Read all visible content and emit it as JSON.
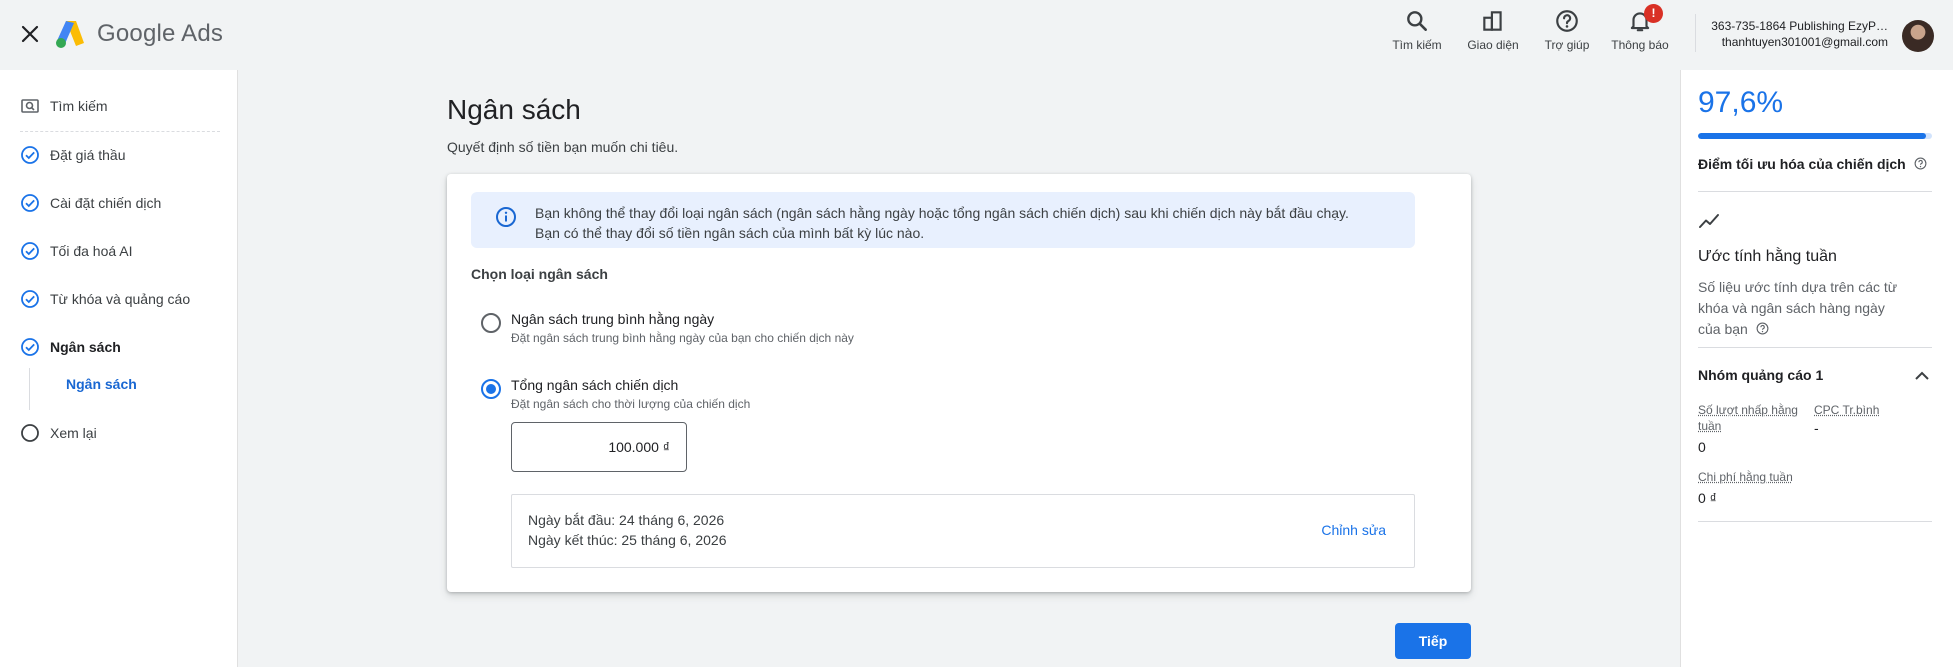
{
  "topbar": {
    "brand": "Google Ads",
    "tools": [
      {
        "label": "Tìm kiếm",
        "icon": "search-icon"
      },
      {
        "label": "Giao diện",
        "icon": "appearance-icon"
      },
      {
        "label": "Trợ giúp",
        "icon": "help-icon"
      },
      {
        "label": "Thông báo",
        "icon": "bell-icon",
        "badge": "!"
      }
    ],
    "account_line1": "363-735-1864 Publishing EzyP…",
    "account_email": "thanhtuyen301001@gmail.com"
  },
  "sidebar": {
    "items": [
      {
        "label": "Tìm kiếm",
        "icon": "search-box-icon",
        "status": "search"
      },
      {
        "label": "Đặt giá thầu",
        "icon": "check-circle-icon",
        "status": "done"
      },
      {
        "label": "Cài đặt chiến dịch",
        "icon": "check-circle-icon",
        "status": "done"
      },
      {
        "label": "Tối đa hoá AI",
        "icon": "check-circle-icon",
        "status": "done"
      },
      {
        "label": "Từ khóa và quảng cáo",
        "icon": "check-circle-icon",
        "status": "done"
      },
      {
        "label": "Ngân sách",
        "icon": "check-circle-icon",
        "status": "current"
      },
      {
        "label": "Xem lại",
        "icon": "empty-circle-icon",
        "status": "pending"
      }
    ],
    "sub_item": "Ngân sách"
  },
  "main": {
    "title": "Ngân sách",
    "subtitle": "Quyết định số tiền bạn muốn chi tiêu.",
    "info_line1": "Bạn không thể thay đổi loại ngân sách (ngân sách hằng ngày hoặc tổng ngân sách chiến dịch) sau khi chiến dịch này bắt đầu chạy.",
    "info_line2": "Bạn có thể thay đổi số tiền ngân sách của mình bất kỳ lúc nào.",
    "section_title": "Chọn loại ngân sách",
    "options": [
      {
        "label": "Ngân sách trung bình hằng ngày",
        "desc": "Đặt ngân sách trung bình hằng ngày của bạn cho chiến dịch này",
        "selected": false
      },
      {
        "label": "Tổng ngân sách chiến dịch",
        "desc": "Đặt ngân sách cho thời lượng của chiến dịch",
        "selected": true
      }
    ],
    "amount": "100.000 ₫",
    "start_date": "Ngày bắt đầu: 24 tháng 6, 2026",
    "end_date": "Ngày kết thúc: 25 tháng 6, 2026",
    "edit_label": "Chỉnh sửa",
    "next_label": "Tiếp"
  },
  "right_panel": {
    "score": "97,6%",
    "score_value": 0.976,
    "score_label": "Điểm tối ưu hóa của chiến dịch",
    "est_title": "Ước tính hằng tuần",
    "est_desc": "Số liệu ước tính dựa trên các từ khóa và ngân sách hàng ngày của bạn",
    "group_title": "Nhóm quảng cáo 1",
    "metrics": {
      "clicks_label": "Số lượt nhấp hằng tuần",
      "clicks_value": "0",
      "cpc_label": "CPC Tr.bình",
      "cpc_value": "-",
      "cost_label": "Chi phí hằng tuần",
      "cost_value": "0 ₫"
    }
  },
  "colors": {
    "accent": "#1a73e8",
    "badge": "#d93025",
    "info_bg": "#e8f0fe"
  }
}
